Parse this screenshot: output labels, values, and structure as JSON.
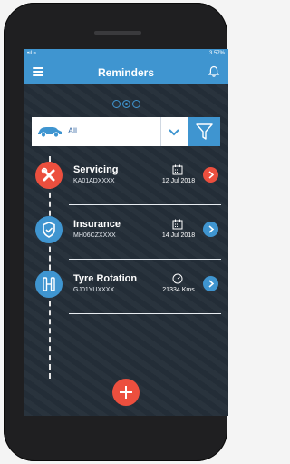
{
  "status": {
    "left": "•ıl ≈",
    "right": "3 57%"
  },
  "appbar": {
    "title": "Reminders"
  },
  "filter": {
    "selected": "All"
  },
  "reminders": [
    {
      "name": "Servicing",
      "reg": "KA01ADXXXX",
      "meta": "12 Jul 2018",
      "icon": "wrench-icon",
      "meta_icon": "calendar-icon",
      "color": "#ec4f3e"
    },
    {
      "name": "Insurance",
      "reg": "MH06CZXXXX",
      "meta": "14 Jul 2018",
      "icon": "shield-icon",
      "meta_icon": "calendar-icon",
      "color": "#3f95d0"
    },
    {
      "name": "Tyre Rotation",
      "reg": "GJ01YUXXXX",
      "meta": "21334 Kms",
      "icon": "tyre-icon",
      "meta_icon": "speedometer-icon",
      "color": "#3f95d0"
    }
  ],
  "colors": {
    "primary": "#3f95d0",
    "accent": "#ec4f3e",
    "background": "#242e38"
  }
}
